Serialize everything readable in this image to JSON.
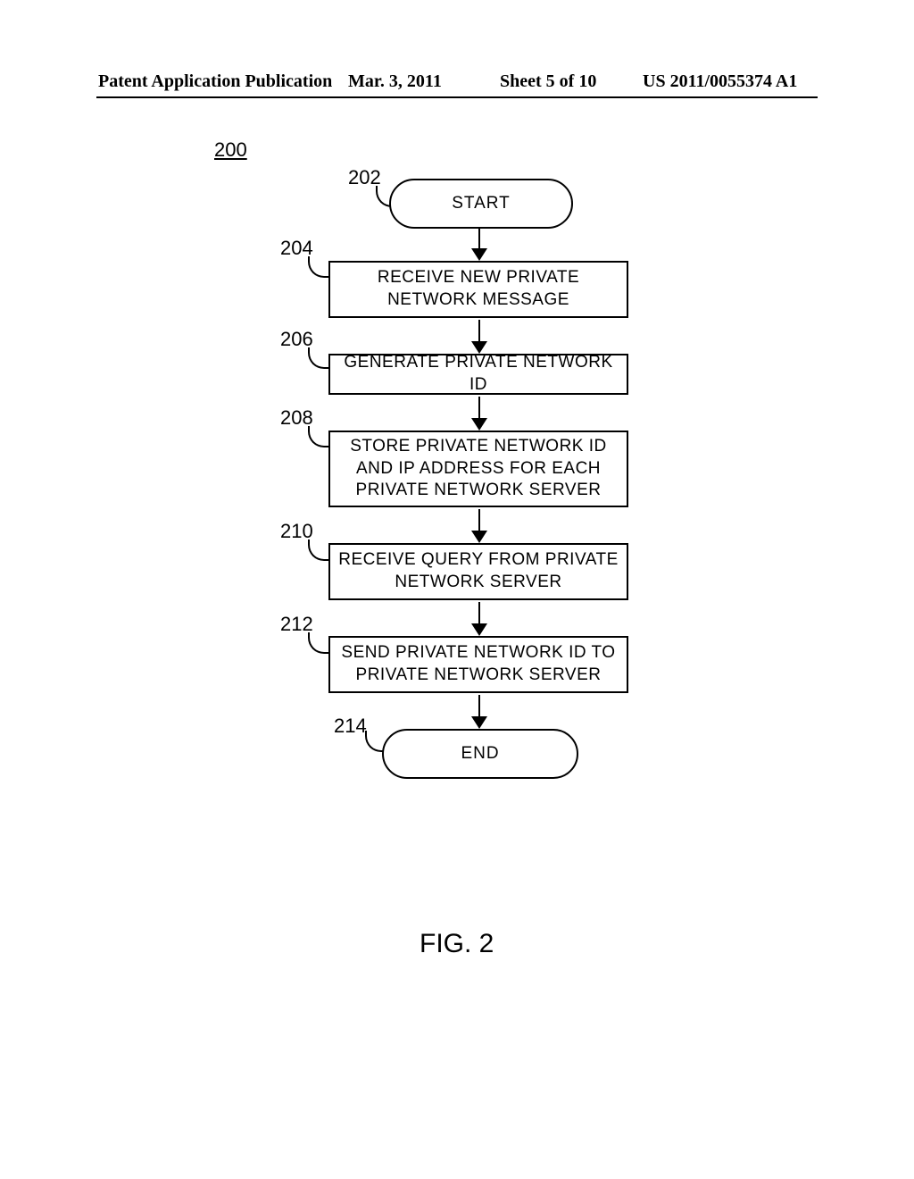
{
  "header": {
    "publication_label": "Patent Application Publication",
    "date": "Mar. 3, 2011",
    "sheet": "Sheet 5 of 10",
    "pub_number": "US 2011/0055374 A1"
  },
  "diagram": {
    "overall_ref": "200",
    "nodes": {
      "n202": {
        "ref": "202",
        "label": "START"
      },
      "n204": {
        "ref": "204",
        "label": "RECEIVE NEW PRIVATE NETWORK MESSAGE"
      },
      "n206": {
        "ref": "206",
        "label": "GENERATE PRIVATE NETWORK ID"
      },
      "n208": {
        "ref": "208",
        "label": "STORE PRIVATE NETWORK ID AND IP ADDRESS FOR EACH PRIVATE NETWORK SERVER"
      },
      "n210": {
        "ref": "210",
        "label": "RECEIVE QUERY FROM PRIVATE NETWORK SERVER"
      },
      "n212": {
        "ref": "212",
        "label": "SEND PRIVATE NETWORK ID TO PRIVATE NETWORK SERVER"
      },
      "n214": {
        "ref": "214",
        "label": "END"
      }
    }
  },
  "figure_caption": "FIG. 2"
}
